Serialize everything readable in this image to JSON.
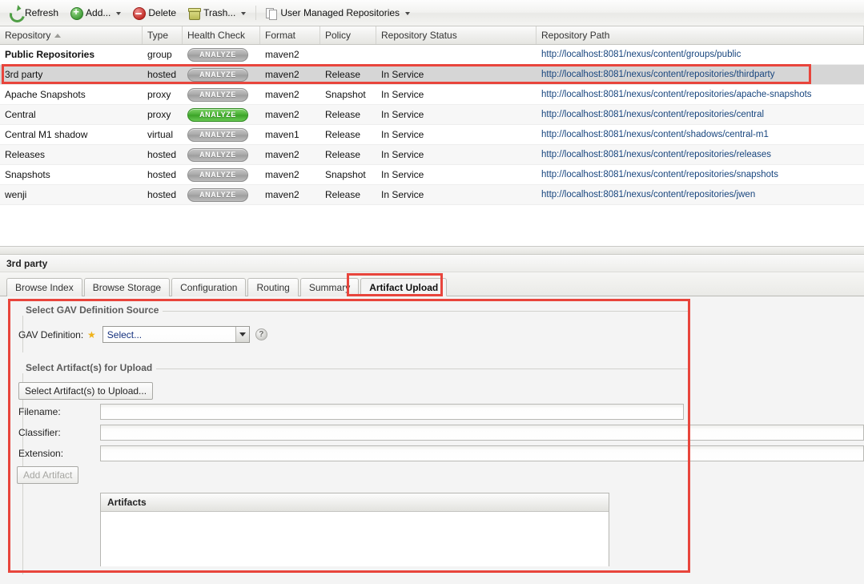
{
  "toolbar": {
    "items": [
      {
        "label": "Refresh",
        "icon": "refresh-icon",
        "has_menu": false
      },
      {
        "label": "Add...",
        "icon": "add-circle-icon",
        "has_menu": true
      },
      {
        "label": "Delete",
        "icon": "delete-circle-icon",
        "has_menu": false
      },
      {
        "label": "Trash...",
        "icon": "trash-icon",
        "has_menu": true
      },
      {
        "label": "User Managed Repositories",
        "icon": "pages-icon",
        "has_menu": true
      }
    ]
  },
  "grid": {
    "columns": [
      {
        "key": "repository",
        "label": "Repository",
        "sorted": "asc"
      },
      {
        "key": "type",
        "label": "Type"
      },
      {
        "key": "health",
        "label": "Health Check"
      },
      {
        "key": "format",
        "label": "Format"
      },
      {
        "key": "policy",
        "label": "Policy"
      },
      {
        "key": "status",
        "label": "Repository Status"
      },
      {
        "key": "path",
        "label": "Repository Path"
      }
    ],
    "analyze_label": "ANALYZE",
    "rows": [
      {
        "repository": "Public Repositories",
        "bold": true,
        "type": "group",
        "health": "ANALYZE",
        "health_state": "inactive",
        "format": "maven2",
        "policy": "",
        "status": "",
        "path": "http://localhost:8081/nexus/content/groups/public",
        "selected": false
      },
      {
        "repository": "3rd party",
        "bold": false,
        "type": "hosted",
        "health": "ANALYZE",
        "health_state": "inactive",
        "format": "maven2",
        "policy": "Release",
        "status": "In Service",
        "path": "http://localhost:8081/nexus/content/repositories/thirdparty",
        "selected": true
      },
      {
        "repository": "Apache Snapshots",
        "bold": false,
        "type": "proxy",
        "health": "ANALYZE",
        "health_state": "inactive",
        "format": "maven2",
        "policy": "Snapshot",
        "status": "In Service",
        "path": "http://localhost:8081/nexus/content/repositories/apache-snapshots",
        "selected": false
      },
      {
        "repository": "Central",
        "bold": false,
        "type": "proxy",
        "health": "ANALYZE",
        "health_state": "active",
        "format": "maven2",
        "policy": "Release",
        "status": "In Service",
        "path": "http://localhost:8081/nexus/content/repositories/central",
        "selected": false
      },
      {
        "repository": "Central M1 shadow",
        "bold": false,
        "type": "virtual",
        "health": "ANALYZE",
        "health_state": "inactive",
        "format": "maven1",
        "policy": "Release",
        "status": "In Service",
        "path": "http://localhost:8081/nexus/content/shadows/central-m1",
        "selected": false
      },
      {
        "repository": "Releases",
        "bold": false,
        "type": "hosted",
        "health": "ANALYZE",
        "health_state": "inactive",
        "format": "maven2",
        "policy": "Release",
        "status": "In Service",
        "path": "http://localhost:8081/nexus/content/repositories/releases",
        "selected": false
      },
      {
        "repository": "Snapshots",
        "bold": false,
        "type": "hosted",
        "health": "ANALYZE",
        "health_state": "inactive",
        "format": "maven2",
        "policy": "Snapshot",
        "status": "In Service",
        "path": "http://localhost:8081/nexus/content/repositories/snapshots",
        "selected": false
      },
      {
        "repository": "wenji",
        "bold": false,
        "type": "hosted",
        "health": "ANALYZE",
        "health_state": "inactive",
        "format": "maven2",
        "policy": "Release",
        "status": "In Service",
        "path": "http://localhost:8081/nexus/content/repositories/jwen",
        "selected": false
      }
    ]
  },
  "detail": {
    "title": "3rd party",
    "tabs": [
      {
        "label": "Browse Index",
        "active": false
      },
      {
        "label": "Browse Storage",
        "active": false
      },
      {
        "label": "Configuration",
        "active": false
      },
      {
        "label": "Routing",
        "active": false
      },
      {
        "label": "Summary",
        "active": false
      },
      {
        "label": "Artifact Upload",
        "active": true
      }
    ]
  },
  "upload": {
    "gav_section_legend": "Select GAV Definition Source",
    "gav_label": "GAV Definition:",
    "gav_required_marker": "★",
    "gav_value": "Select...",
    "gav_help": "?",
    "artifacts_section_legend": "Select Artifact(s) for Upload",
    "select_artifact_button": "Select Artifact(s) to Upload...",
    "fields": [
      {
        "label": "Filename:",
        "value": "",
        "placeholder": ""
      },
      {
        "label": "Classifier:",
        "value": "",
        "placeholder": ""
      },
      {
        "label": "Extension:",
        "value": "",
        "placeholder": ""
      }
    ],
    "add_artifact_button": "Add Artifact",
    "artifacts_grid_title": "Artifacts"
  },
  "colors": {
    "annotation": "#e8453c",
    "link": "#17457e",
    "health_active": "#44ad2f",
    "health_inactive": "#a8a8a8",
    "selected_row": "#d6d6d6"
  }
}
